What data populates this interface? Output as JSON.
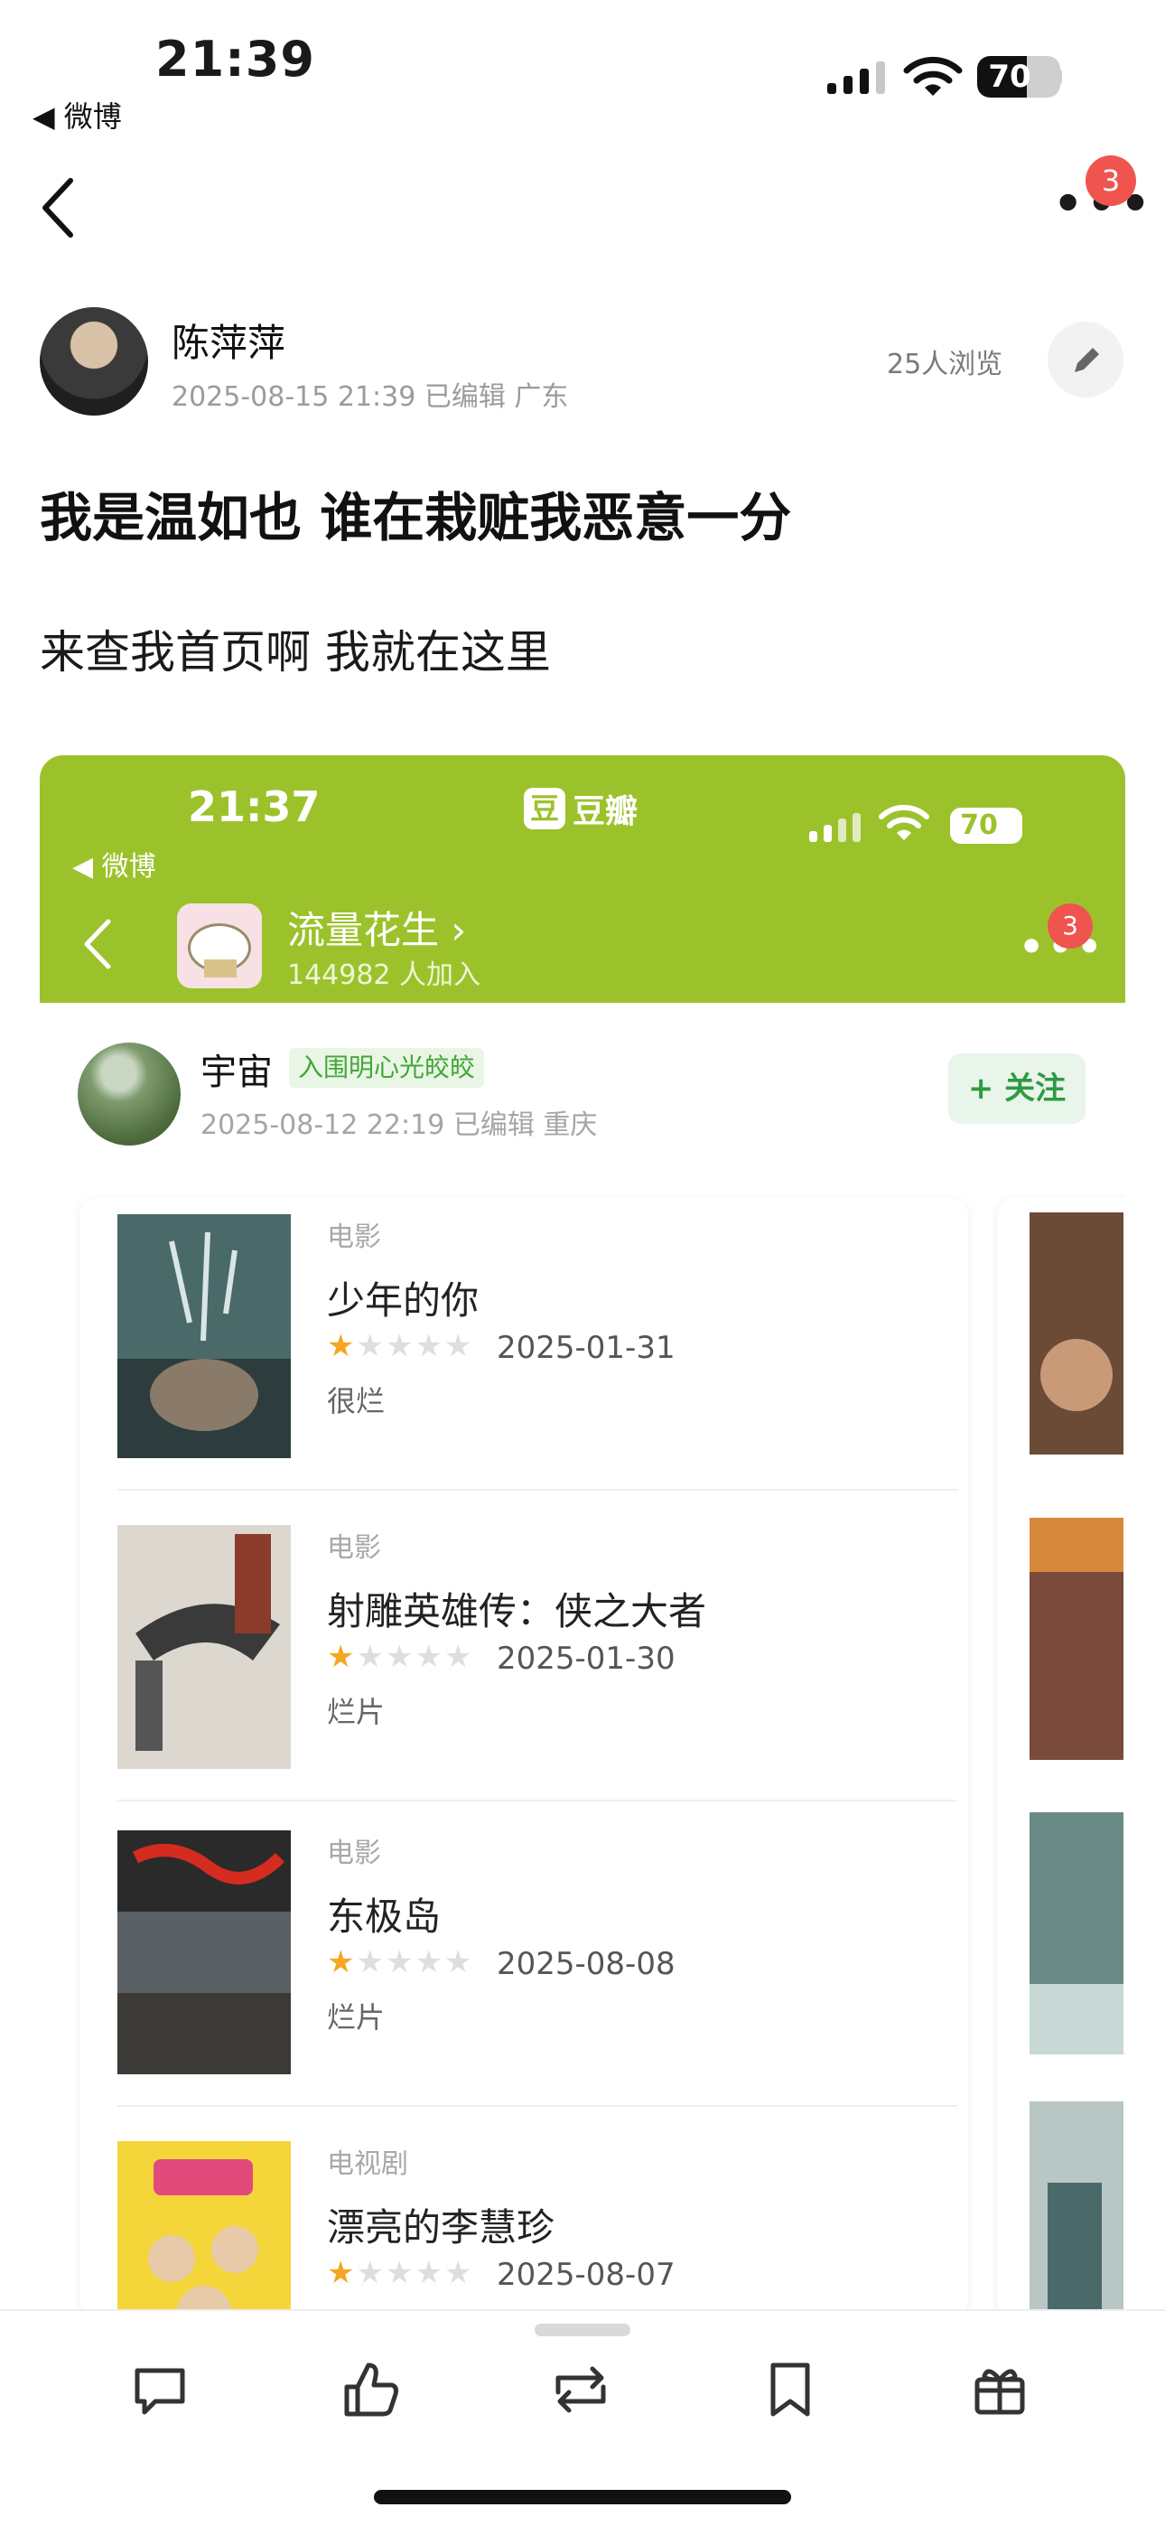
{
  "status": {
    "time": "21:39",
    "back_app": "◀ 微博",
    "battery": "70",
    "battery_level": 0.7
  },
  "nav": {
    "badge": "3",
    "more_icon": "more-icon"
  },
  "post": {
    "author": "陈萍萍",
    "meta": "2025-08-15 21:39  已编辑  广东",
    "views": "25人浏览",
    "title": "我是温如也 谁在栽赃我恶意一分",
    "body": "来查我首页啊 我就在这里"
  },
  "embed": {
    "status_time": "21:37",
    "back_app": "◀ 微博",
    "app_logo_glyph": "豆",
    "app_name": "豆瓣",
    "battery": "70",
    "group_name": "流量花生 ›",
    "group_count": "144982 人加入",
    "badge": "3",
    "user": "宇宙",
    "user_tag": "入围明心光皎皎",
    "user_meta": "2025-08-12 22:19  已编辑  重庆",
    "follow": "+ 关注",
    "header_color": "#9cc22b",
    "movies": [
      {
        "type": "电影",
        "title": "少年的你",
        "rating": 1,
        "date": "2025-01-31",
        "comment": "很烂"
      },
      {
        "type": "电影",
        "title": "射雕英雄传：侠之大者",
        "rating": 1,
        "date": "2025-01-30",
        "comment": "烂片"
      },
      {
        "type": "电影",
        "title": "东极岛",
        "rating": 1,
        "date": "2025-08-08",
        "comment": "烂片"
      },
      {
        "type": "电视剧",
        "title": "漂亮的李慧珍",
        "rating": 1,
        "date": "2025-08-07",
        "comment": ""
      }
    ]
  },
  "actions": [
    "comment-icon",
    "like-icon",
    "repost-icon",
    "bookmark-icon",
    "gift-icon"
  ],
  "colors": {
    "badge": "#f0544f",
    "star": "#f5a623",
    "follow_green": "#2f9a43"
  }
}
